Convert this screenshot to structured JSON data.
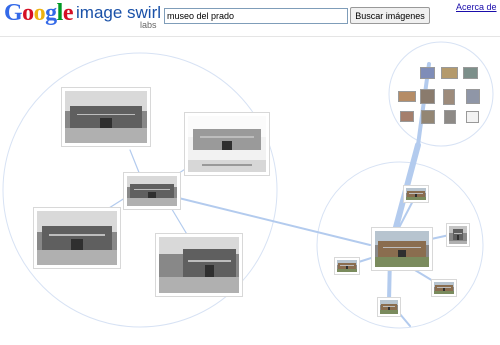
{
  "app": {
    "brand": "Google",
    "title": "image swirl",
    "badge": "labs"
  },
  "search": {
    "query": "museo del prado",
    "button_label": "Buscar imágenes"
  },
  "header": {
    "about_link": "Acerca de"
  },
  "colors": {
    "google_blue": "#3369e8",
    "google_red": "#d50f25",
    "google_yellow": "#eeb211",
    "google_green": "#009925",
    "swirl_blue": "#1a51a8",
    "connector_blue": "#b3cbee"
  }
}
